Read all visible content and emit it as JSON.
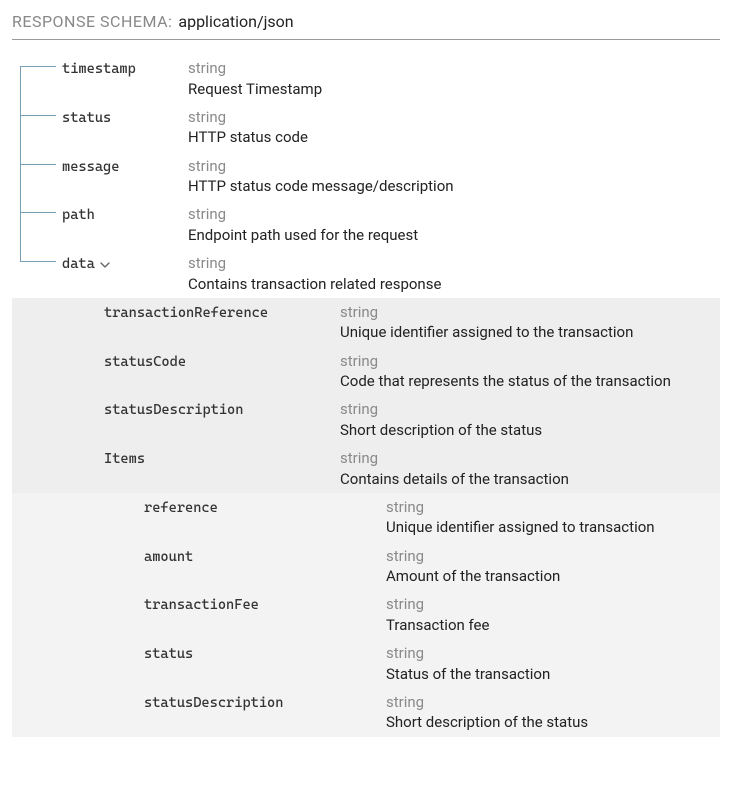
{
  "header": {
    "label": "RESPONSE SCHEMA:",
    "value": "application/json"
  },
  "fields": {
    "timestamp": {
      "name": "timestamp",
      "type": "string",
      "desc": "Request Timestamp"
    },
    "status": {
      "name": "status",
      "type": "string",
      "desc": "HTTP status code"
    },
    "message": {
      "name": "message",
      "type": "string",
      "desc": "HTTP status code message/description"
    },
    "path": {
      "name": "path",
      "type": "string",
      "desc": "Endpoint path used for the request"
    },
    "data": {
      "name": "data",
      "type": "string",
      "desc": "Contains transaction related response"
    },
    "transactionReference": {
      "name": "transactionReference",
      "type": "string",
      "desc": "Unique identifier assigned to the transaction"
    },
    "statusCode": {
      "name": "statusCode",
      "type": "string",
      "desc": "Code that represents the status of the transaction"
    },
    "statusDescription": {
      "name": "statusDescription",
      "type": "string",
      "desc": "Short description of the status"
    },
    "items": {
      "name": "Items",
      "type": "string",
      "desc": "Contains details of the transaction"
    },
    "reference": {
      "name": "reference",
      "type": "string",
      "desc": "Unique identifier assigned to transaction"
    },
    "amount": {
      "name": "amount",
      "type": "string",
      "desc": "Amount of the transaction"
    },
    "transactionFee": {
      "name": "transactionFee",
      "type": "string",
      "desc": "Transaction fee"
    },
    "status2": {
      "name": "status",
      "type": "string",
      "desc": "Status of the transaction"
    },
    "statusDescription2": {
      "name": "statusDescription",
      "type": "string",
      "desc": "Short description of the status"
    }
  }
}
